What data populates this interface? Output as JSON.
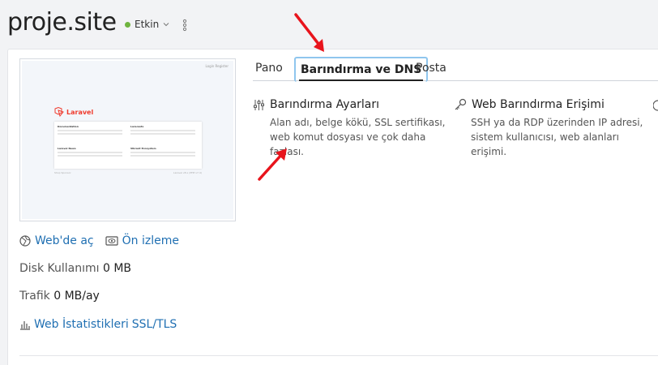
{
  "header": {
    "title": "proje.site",
    "status_label": "Etkin",
    "status_color": "#6fb43f"
  },
  "thumbnail": {
    "logo_text": "Laravel",
    "top_links": "Login  Register",
    "cells": [
      {
        "title": "Documentation"
      },
      {
        "title": "Laracasts"
      },
      {
        "title": "Laravel News"
      },
      {
        "title": "Vibrant Ecosystem"
      }
    ],
    "footer_left": "Shop  Sponsor",
    "footer_right": "Laravel v8.x (PHP v7.4)"
  },
  "links": {
    "open_web": "Web'de aç",
    "preview": "Ön izleme"
  },
  "stats": {
    "disk_label": "Disk Kullanımı",
    "disk_value": "0 MB",
    "traffic_label": "Trafik",
    "traffic_value": "0 MB/ay",
    "web_stats": "Web İstatistikleri",
    "ssl": "SSL/TLS"
  },
  "tabs": [
    {
      "label": "Pano"
    },
    {
      "label": "Barındırma ve DNS",
      "active": true
    },
    {
      "label": "Posta"
    }
  ],
  "features": [
    {
      "title": "Barındırma Ayarları",
      "desc_line1": "Alan adı, belge kökü, SSL sertifikası,",
      "desc_line2": "web komut dosyası ve çok daha fazlası."
    },
    {
      "title": "Web Barındırma Erişimi",
      "desc_line1": "SSH ya da RDP üzerinden IP adresi,",
      "desc_line2": "sistem kullanıcısı, web alanları erişimi."
    }
  ],
  "colors": {
    "link": "#1f6fb2",
    "annotation_arrow": "#e8141c",
    "active_tab_outline": "#8fc6ee"
  }
}
